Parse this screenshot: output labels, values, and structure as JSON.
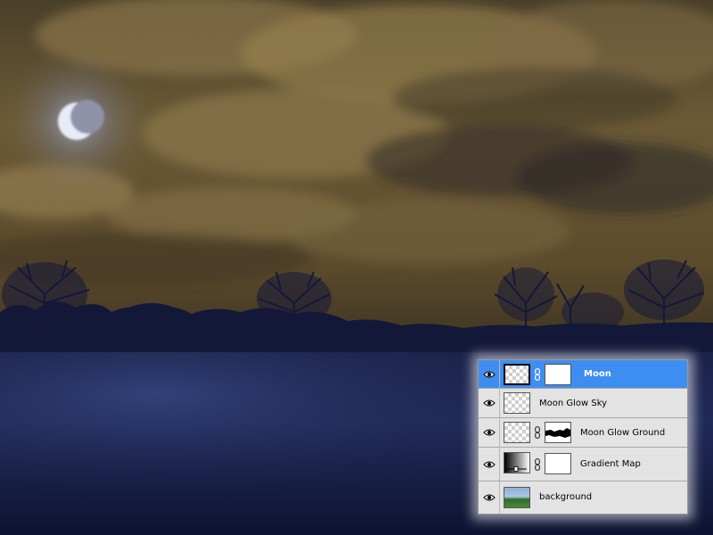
{
  "layers_panel": {
    "layers": [
      {
        "name": "Moon",
        "selected": true
      },
      {
        "name": "Moon Glow Sky",
        "selected": false
      },
      {
        "name": "Moon Glow Ground",
        "selected": false
      },
      {
        "name": "Gradient Map",
        "selected": false
      },
      {
        "name": "background",
        "selected": false
      }
    ]
  },
  "icons": {
    "visibility": "eye-icon",
    "link": "chain-link-icon"
  },
  "colors": {
    "selected_row": "#3d8ef0",
    "panel_bg": "#e3e3e3",
    "sky_gold": "#7a6a3f",
    "ground_blue": "#141b3d"
  }
}
